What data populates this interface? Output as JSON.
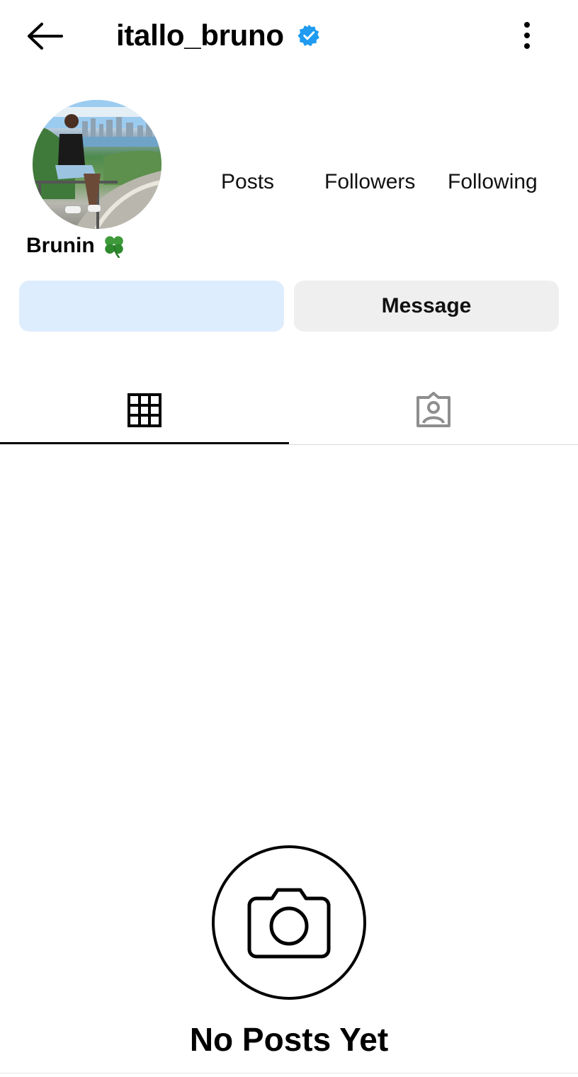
{
  "header": {
    "username": "itallo_bruno",
    "verified": true,
    "back_icon": "arrow-left-icon",
    "more_icon": "more-vertical-icon",
    "verified_color": "#1f9bf0"
  },
  "profile": {
    "display_name": "Brunin",
    "display_name_emoji": "four-leaf-clover-icon",
    "avatar": "profile-photo",
    "stats": {
      "posts_label": "Posts",
      "followers_label": "Followers",
      "following_label": "Following"
    }
  },
  "actions": {
    "follow_label": "",
    "message_label": "Message",
    "follow_bg": "#deedfd",
    "message_bg": "#efefef"
  },
  "tabs": [
    {
      "icon": "grid-icon",
      "active": true
    },
    {
      "icon": "tagged-person-icon",
      "active": false
    }
  ],
  "empty_state": {
    "icon": "camera-icon",
    "title": "No Posts Yet"
  }
}
